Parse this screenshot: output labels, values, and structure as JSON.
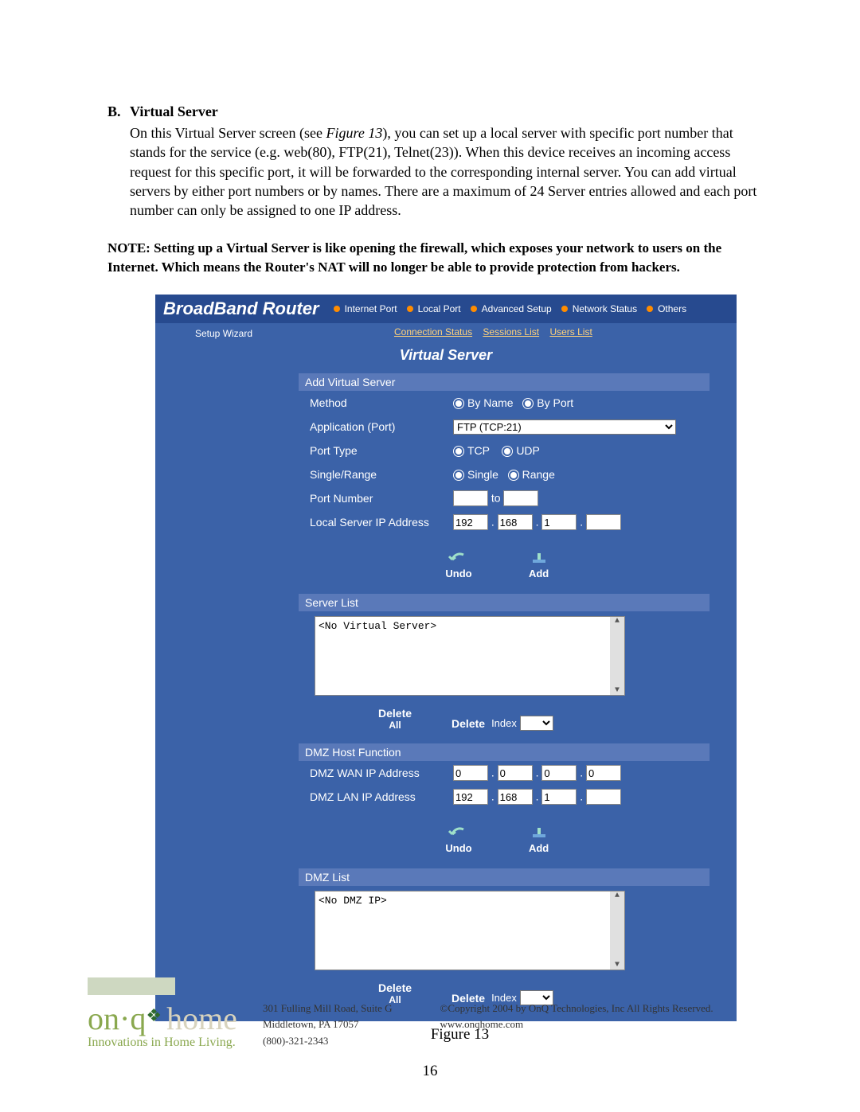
{
  "heading": {
    "label": "B.",
    "title": "Virtual Server"
  },
  "paragraph": {
    "pre": "On this Virtual Server  screen (see ",
    "figref": "Figure 13",
    "post": "), you can set up a local server with specific port number that stands for the service (e.g. web(80), FTP(21), Telnet(23)). When this device receives an incoming access request for this specific port, it will be forwarded to the corresponding internal server. You can add virtual servers by either port numbers or by names. There are a maximum of 24 Server entries allowed and each port number can only be assigned to one IP address."
  },
  "note": "NOTE: Setting up a Virtual Server is like opening the firewall, which exposes your network to users on the Internet. Which means the Router's NAT will no longer be able to provide protection from hackers.",
  "router": {
    "brand": "BroadBand Router",
    "nav": [
      "Internet Port",
      "Local Port",
      "Advanced Setup",
      "Network Status",
      "Others"
    ],
    "wizard": "Setup Wizard",
    "subnav": [
      "Connection Status",
      "Sessions List",
      "Users List"
    ],
    "title": "Virtual Server",
    "sections": {
      "add": "Add Virtual Server",
      "serverlist": "Server List",
      "dmzhost": "DMZ Host Function",
      "dmzlist": "DMZ List"
    },
    "labels": {
      "method": "Method",
      "app": "Application (Port)",
      "porttype": "Port Type",
      "singlerange": "Single/Range",
      "portnum": "Port Number",
      "localip": "Local Server IP Address",
      "dmzwan": "DMZ WAN IP Address",
      "dmzlan": "DMZ LAN IP Address",
      "to": "to",
      "index": "Index"
    },
    "radios": {
      "byname": "By Name",
      "byport": "By Port",
      "tcp": "TCP",
      "udp": "UDP",
      "single": "Single",
      "range": "Range"
    },
    "app_select": "FTP (TCP:21)",
    "ip": {
      "local": [
        "192",
        "168",
        "1",
        ""
      ],
      "dmzwan": [
        "0",
        "0",
        "0",
        "0"
      ],
      "dmzlan": [
        "192",
        "168",
        "1",
        ""
      ]
    },
    "portnum": [
      "",
      ""
    ],
    "list_empty_server": "<No Virtual Server>",
    "list_empty_dmz": "<No DMZ IP>",
    "buttons": {
      "undo": "Undo",
      "add": "Add",
      "delete": "Delete",
      "deleteall_top": "Delete",
      "deleteall_bot": "All"
    }
  },
  "caption": "Figure 13",
  "footer": {
    "tagline": "Innovations in Home Living.",
    "addr": [
      "301 Fulling Mill Road, Suite G",
      "Middletown, PA   17057",
      "(800)-321-2343"
    ],
    "right": [
      "©Copyright 2004 by OnQ Technologies, Inc All Rights Reserved.",
      "www.onqhome.com"
    ]
  },
  "pagenum": "16"
}
